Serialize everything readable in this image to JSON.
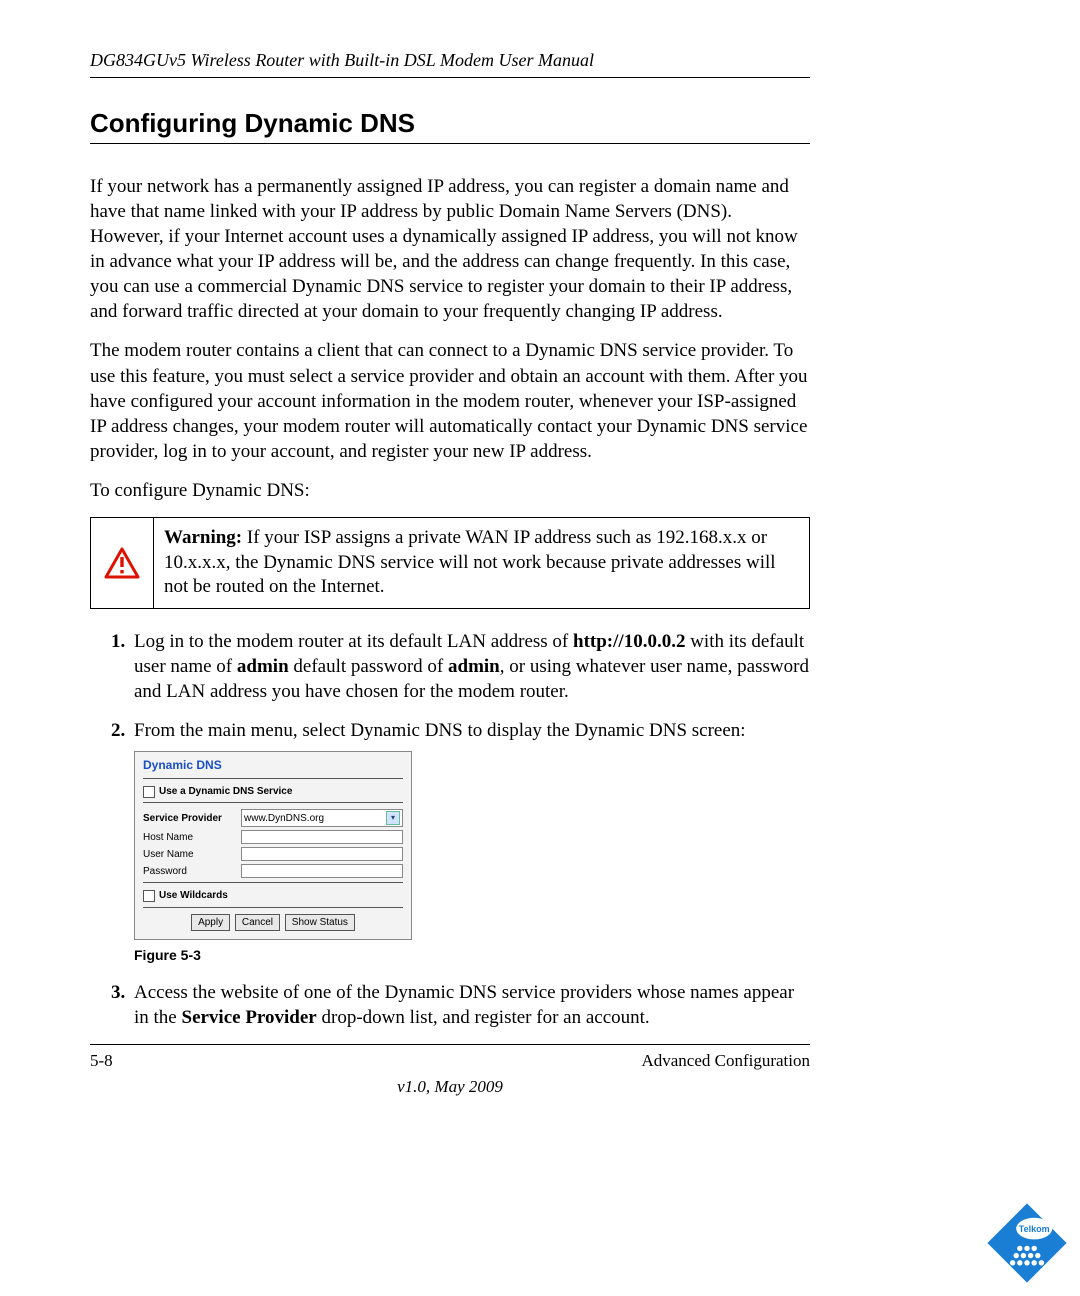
{
  "header": {
    "running_title": "DG834GUv5 Wireless Router with Built-in DSL Modem User Manual"
  },
  "title": "Configuring Dynamic DNS",
  "paragraphs": {
    "p1": "If your network has a permanently assigned IP address, you can register a domain name and have that name linked with your IP address by public Domain Name Servers (DNS). However, if your Internet account uses a dynamically assigned IP address, you will not know in advance what your IP address will be, and the address can change frequently. In this case, you can use a commercial Dynamic DNS service to register your domain to their IP address, and forward traffic directed at your domain to your frequently changing IP address.",
    "p2": "The modem router contains a client that can connect to a Dynamic DNS service provider. To use this feature, you must select a service provider and obtain an account with them. After you have configured your account information in the modem router, whenever your ISP-assigned IP address changes, your modem router will automatically contact your Dynamic DNS service provider, log in to your account, and register your new IP address.",
    "p3": "To configure Dynamic DNS:"
  },
  "warning": {
    "label": "Warning:",
    "text": " If your ISP assigns a private WAN IP address such as 192.168.x.x or 10.x.x.x, the Dynamic DNS service will not work because private addresses will not be routed on the Internet."
  },
  "steps": {
    "s1_a": "Log in to the modem router at its default LAN address of ",
    "s1_url": "http://10.0.0.2",
    "s1_b": " with its default user name of ",
    "s1_admin1": "admin",
    "s1_c": " default password of ",
    "s1_admin2": "admin",
    "s1_d": ", or using whatever user name, password and LAN address you have chosen for the modem router.",
    "s2": "From the main menu, select Dynamic DNS to display the Dynamic DNS screen:",
    "s3_a": "Access the website of one of the Dynamic DNS service providers whose names appear in the ",
    "s3_bold": "Service Provider",
    "s3_b": " drop-down list, and register for an account."
  },
  "screenshot": {
    "title": "Dynamic DNS",
    "use_service_label": "Use a Dynamic DNS Service",
    "service_provider_label": "Service Provider",
    "service_provider_value": "www.DynDNS.org",
    "host_name_label": "Host Name",
    "user_name_label": "User Name",
    "password_label": "Password",
    "use_wildcards_label": "Use Wildcards",
    "apply_btn": "Apply",
    "cancel_btn": "Cancel",
    "show_status_btn": "Show Status"
  },
  "figure_caption": "Figure 5-3",
  "footer": {
    "page_number": "5-8",
    "section": "Advanced Configuration",
    "version": "v1.0, May 2009",
    "logo_text": "Telkom"
  }
}
